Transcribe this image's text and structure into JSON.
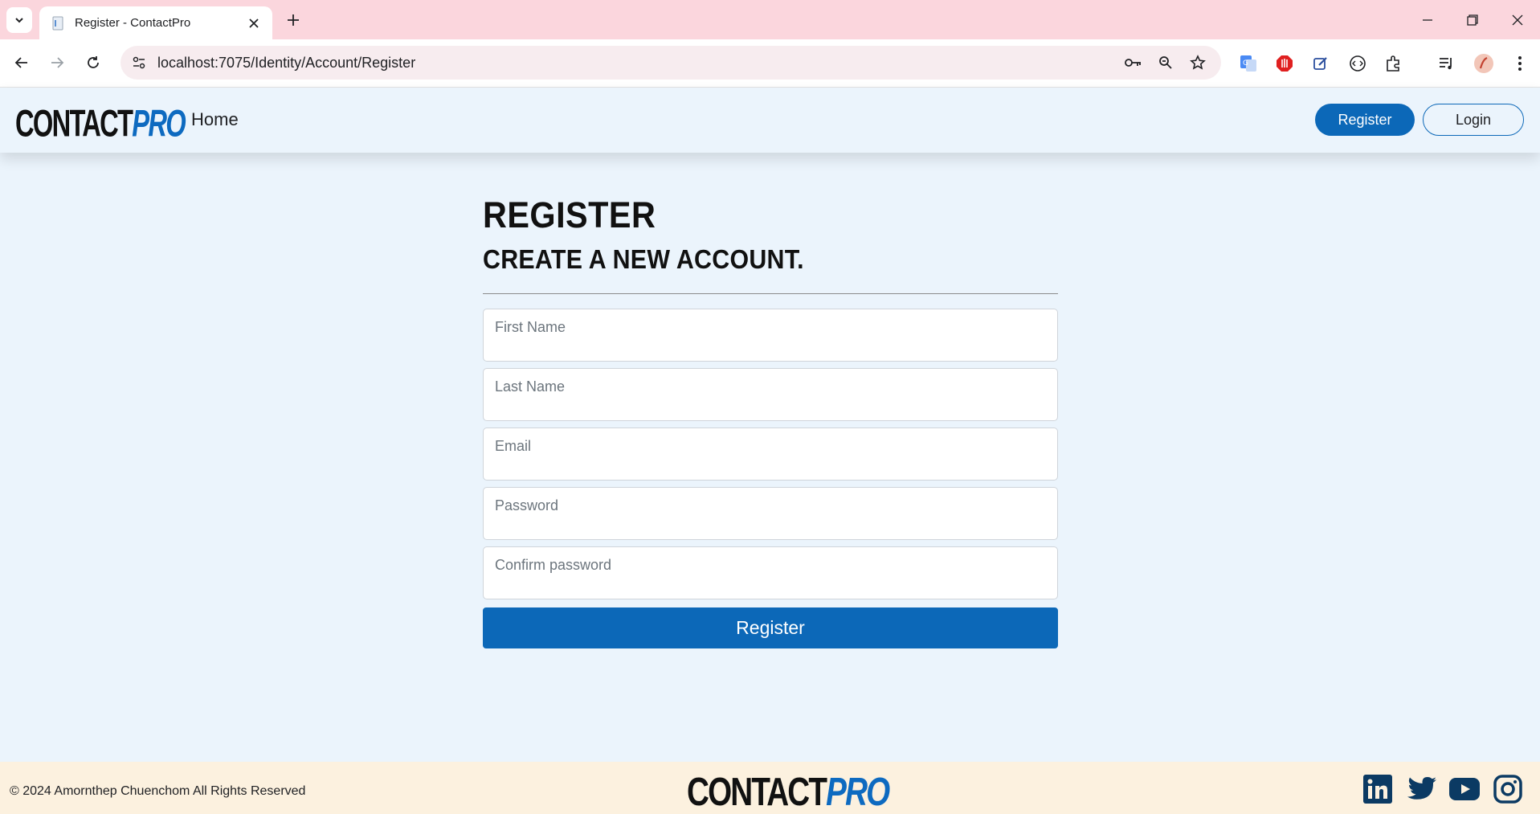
{
  "browser": {
    "tab_title": "Register - ContactPro",
    "url": "localhost:7075/Identity/Account/Register"
  },
  "header": {
    "logo_part1": "CONTACT",
    "logo_part2": "PRO",
    "nav_home": "Home",
    "register_label": "Register",
    "login_label": "Login"
  },
  "form": {
    "title": "REGISTER",
    "subtitle": "CREATE A NEW ACCOUNT.",
    "fields": [
      {
        "label": "First Name"
      },
      {
        "label": "Last Name"
      },
      {
        "label": "Email"
      },
      {
        "label": "Password"
      },
      {
        "label": "Confirm password"
      }
    ],
    "submit_label": "Register"
  },
  "footer": {
    "copyright": "© 2024 Amornthep Chuenchom All Rights Reserved",
    "logo_part1": "CONTACT",
    "logo_part2": "PRO",
    "social_icons": [
      "linkedin-icon",
      "twitter-icon",
      "youtube-icon",
      "instagram-icon"
    ]
  },
  "colors": {
    "primary": "#0c68b8",
    "page_bg": "#ebf4fc",
    "footer_bg": "#fcf1df",
    "tabbar_bg": "#fbd6dd"
  }
}
